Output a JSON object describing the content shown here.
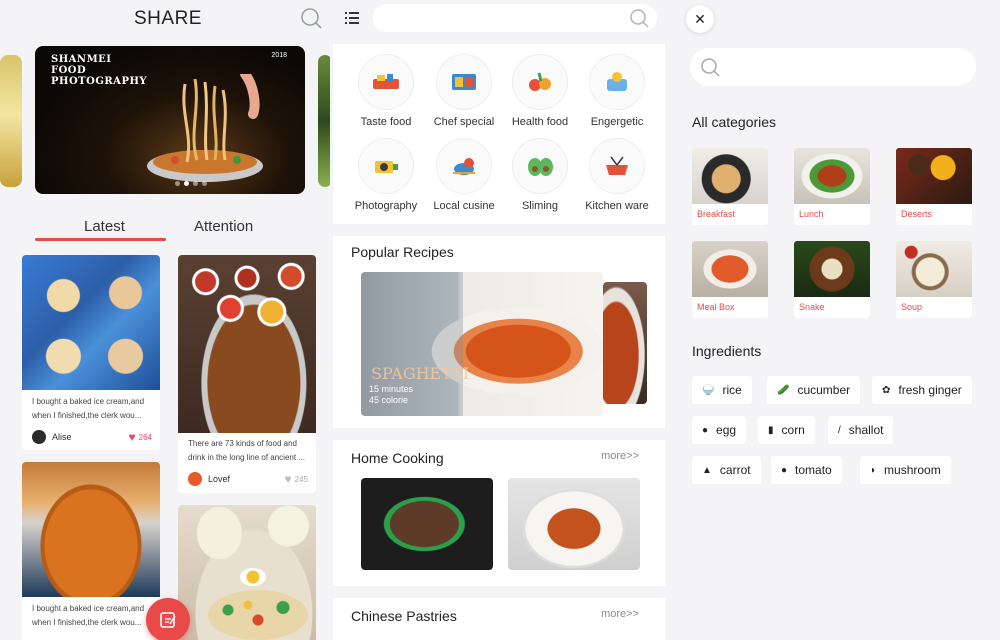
{
  "panel1": {
    "title": "SHARE",
    "banner": {
      "line1": "SHANMEI",
      "line2": "FOOD",
      "line3": "PHOTOGRAPHY",
      "year": "2018"
    },
    "tabs": [
      {
        "label": "Latest",
        "active": true
      },
      {
        "label": "Attention",
        "active": false
      }
    ],
    "cards": [
      {
        "desc": "I bought a baked ice cream,and when I finished,the clerk wou...",
        "user": "Alise",
        "likes": "264"
      },
      {
        "desc": "There are 73 kinds of food and drink in the long line of ancient ...",
        "user": "Lovef",
        "likes": "245"
      },
      {
        "desc": "I bought a baked ice cream,and when I finished,the clerk wou...",
        "user": "",
        "likes": ""
      },
      {
        "desc": "",
        "user": "",
        "likes": ""
      }
    ]
  },
  "panel2": {
    "categories": [
      {
        "label": "Taste food",
        "icon": "food-icon"
      },
      {
        "label": "Chef special",
        "icon": "chef-icon"
      },
      {
        "label": "Health food",
        "icon": "vegetable-icon"
      },
      {
        "label": "Engergetic",
        "icon": "energy-icon"
      },
      {
        "label": "Photography",
        "icon": "camera-icon"
      },
      {
        "label": "Local cusine",
        "icon": "bird-icon"
      },
      {
        "label": "Sliming",
        "icon": "avocado-icon"
      },
      {
        "label": "Kitchen ware",
        "icon": "pot-icon"
      }
    ],
    "popular": {
      "title": "Popular Recipes",
      "dish": "SPAGHETTI",
      "time": "15 minutes",
      "calorie": "45 colorie"
    },
    "home": {
      "title": "Home Cooking",
      "more": "more>>"
    },
    "pastries": {
      "title": "Chinese Pastries",
      "more": "more>>"
    }
  },
  "panel3": {
    "close": "✕",
    "all_categories_title": "All categories",
    "all_categories": [
      "Breakfast",
      "Lunch",
      "Deserts",
      "Meal Box",
      "Snake",
      "Soup"
    ],
    "ingredients_title": "Ingredients",
    "ingredients": [
      "rice",
      "cucumber",
      "fresh ginger",
      "egg",
      "corn",
      "shallot",
      "carrot",
      "tomato",
      "mushroom"
    ]
  },
  "colors": {
    "accent": "#e84a4a",
    "background": "#f4f4f6"
  }
}
